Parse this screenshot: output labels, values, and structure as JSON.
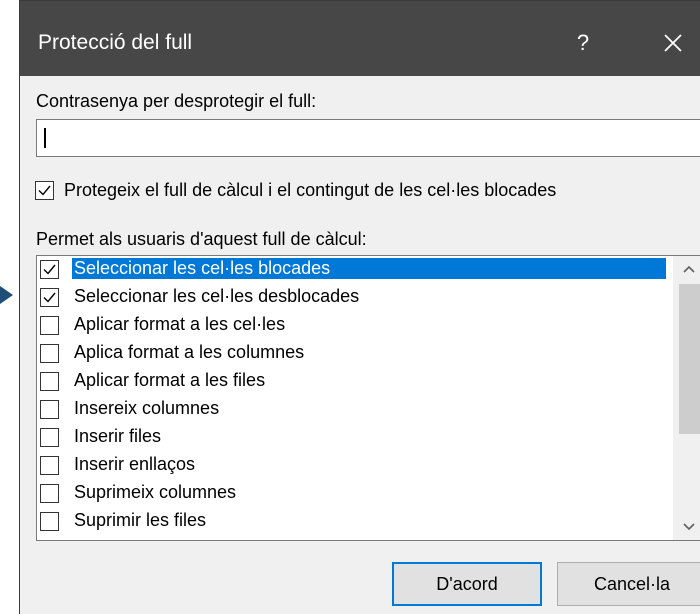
{
  "window": {
    "title": "Protecció del full",
    "help_label": "?"
  },
  "password": {
    "label": "Contrasenya per desprotegir el full:",
    "value": ""
  },
  "protect": {
    "label": "Protegeix el full de càlcul i el contingut de les cel·les blocades",
    "checked": true
  },
  "permissions": {
    "label": "Permet als usuaris d'aquest full de càlcul:",
    "items": [
      {
        "label": "Seleccionar les cel·les blocades",
        "checked": true,
        "selected": true
      },
      {
        "label": "Seleccionar les cel·les desblocades",
        "checked": true,
        "selected": false
      },
      {
        "label": "Aplicar format a les cel·les",
        "checked": false,
        "selected": false
      },
      {
        "label": "Aplica format a les columnes",
        "checked": false,
        "selected": false
      },
      {
        "label": "Aplicar format a les files",
        "checked": false,
        "selected": false
      },
      {
        "label": "Insereix columnes",
        "checked": false,
        "selected": false
      },
      {
        "label": "Inserir files",
        "checked": false,
        "selected": false
      },
      {
        "label": "Inserir enllaços",
        "checked": false,
        "selected": false
      },
      {
        "label": "Suprimeix columnes",
        "checked": false,
        "selected": false
      },
      {
        "label": "Suprimir les files",
        "checked": false,
        "selected": false
      }
    ]
  },
  "buttons": {
    "ok": "D'acord",
    "cancel": "Cancel·la"
  },
  "colors": {
    "titlebar": "#474747",
    "selection": "#0078d7",
    "dialog": "#f0f0f0"
  }
}
